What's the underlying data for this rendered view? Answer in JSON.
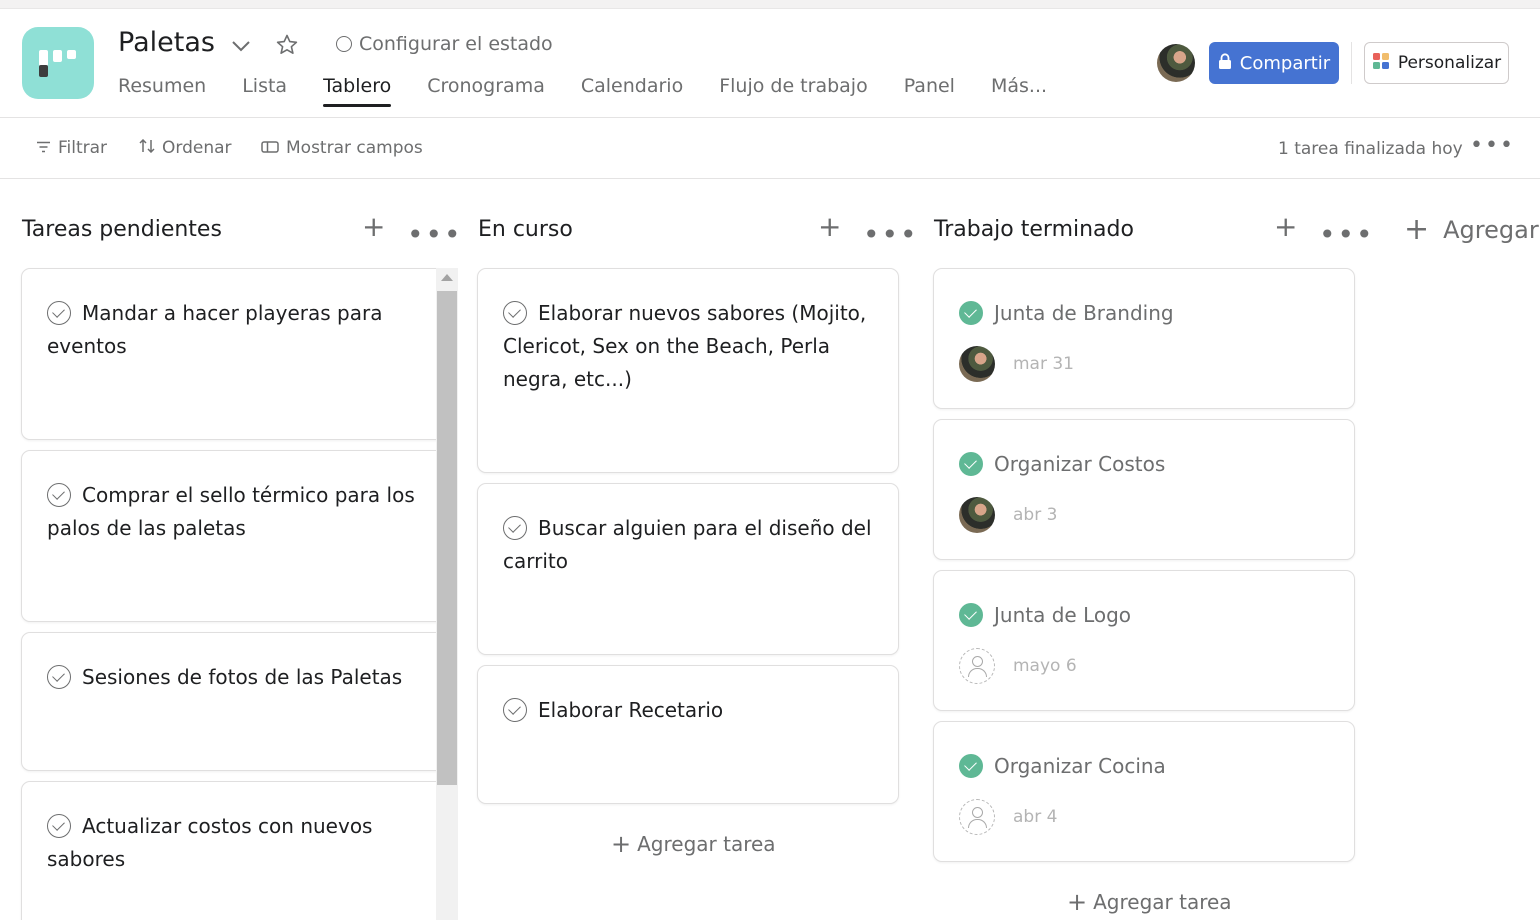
{
  "header": {
    "title": "Paletas",
    "status_label": "Configurar el estado",
    "tabs": [
      {
        "label": "Resumen"
      },
      {
        "label": "Lista"
      },
      {
        "label": "Tablero"
      },
      {
        "label": "Cronograma"
      },
      {
        "label": "Calendario"
      },
      {
        "label": "Flujo de trabajo"
      },
      {
        "label": "Panel"
      },
      {
        "label": "Más..."
      }
    ],
    "active_tab": "Tablero",
    "share_label": "Compartir",
    "customize_label": "Personalizar",
    "accent_color": "#4573d2",
    "project_color": "#8fe0d6"
  },
  "toolbar": {
    "filter_label": "Filtrar",
    "sort_label": "Ordenar",
    "fields_label": "Mostrar campos",
    "finished_text": "1 tarea finalizada hoy"
  },
  "board": {
    "add_section_label": "Agregar s",
    "columns": [
      {
        "title": "Tareas pendientes",
        "cards": [
          {
            "title": "Mandar a hacer playeras para eventos"
          },
          {
            "title": "Comprar el sello térmico para los palos de las paletas"
          },
          {
            "title": "Sesiones de fotos de las Paletas"
          },
          {
            "title": "Actualizar costos con nuevos sabores"
          }
        ]
      },
      {
        "title": "En curso",
        "cards": [
          {
            "title": "Elaborar nuevos sabores (Mojito, Clericot, Sex on the Beach, Perla negra, etc...)"
          },
          {
            "title": "Buscar alguien para el diseño del carrito"
          },
          {
            "title": "Elaborar Recetario"
          }
        ],
        "add_task_label": "Agregar tarea"
      },
      {
        "title": "Trabajo terminado",
        "cards": [
          {
            "title": "Junta de Branding",
            "due": "mar 31",
            "assignee": "avatar"
          },
          {
            "title": "Organizar Costos",
            "due": "abr 3",
            "assignee": "avatar"
          },
          {
            "title": "Junta de Logo",
            "due": "mayo 6",
            "assignee": "empty"
          },
          {
            "title": "Organizar Cocina",
            "due": "abr 4",
            "assignee": "empty"
          }
        ],
        "add_task_label": "Agregar tarea",
        "completed_color": "#5fb895"
      }
    ]
  }
}
